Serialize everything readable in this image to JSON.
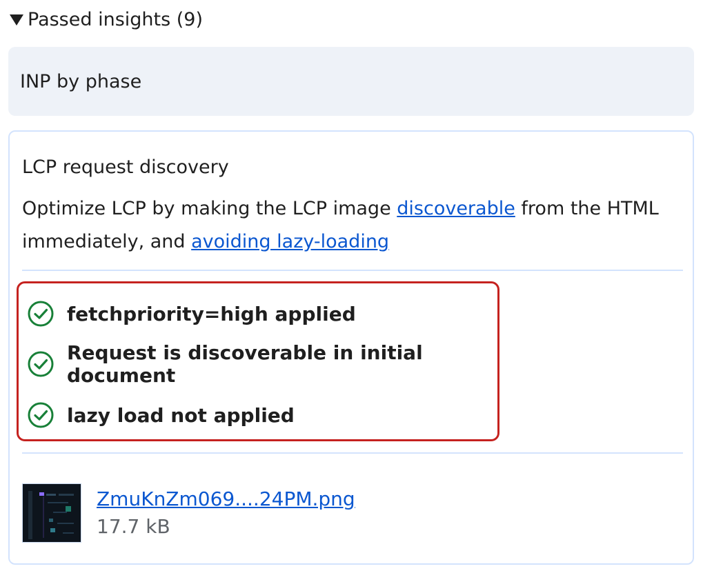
{
  "summary": {
    "label": "Passed insights (9)"
  },
  "inp_card": {
    "title": "INP by phase"
  },
  "lcp_card": {
    "title": "LCP request discovery",
    "description_part1": "Optimize LCP by making the LCP image ",
    "link_discoverable": "discoverable",
    "description_part2": " from the HTML immediately, and ",
    "link_lazy": "avoiding lazy-loading",
    "checks": [
      {
        "label": "fetchpriority=high applied",
        "icon": "check-circle-icon"
      },
      {
        "label": "Request is discoverable in initial document",
        "icon": "check-circle-icon"
      },
      {
        "label": "lazy load not applied",
        "icon": "check-circle-icon"
      }
    ],
    "file": {
      "name": "ZmuKnZm069....24PM.png",
      "size": "17.7 kB"
    }
  },
  "colors": {
    "link": "#0b57d0",
    "check": "#188038",
    "highlight_border": "#c5221f",
    "card_bg": "#eef2f8",
    "card_border": "#d3e3fd"
  }
}
